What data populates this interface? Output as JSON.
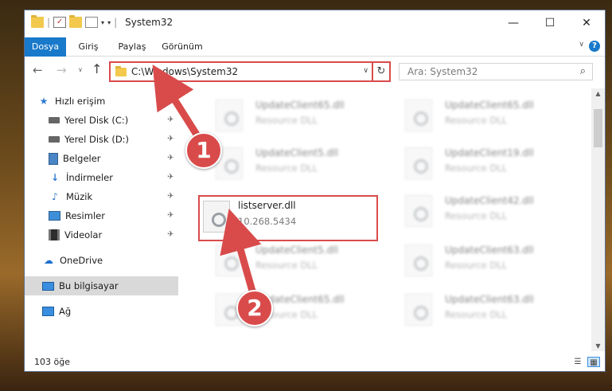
{
  "window": {
    "title": "System32",
    "qat_separator": "|",
    "qat_dropdown": "▾",
    "qat_menu": "▾",
    "controls": {
      "minimize": "—",
      "maximize": "☐",
      "close": "✕"
    }
  },
  "ribbon": {
    "tabs": [
      "Dosya",
      "Giriş",
      "Paylaş",
      "Görünüm"
    ],
    "expand_glyph": "∨",
    "help_glyph": "?"
  },
  "nav": {
    "back_glyph": "←",
    "forward_glyph": "→",
    "history_glyph": "∨",
    "up_glyph": "↑",
    "address": "C:\\Windows\\System32",
    "address_dropdown": "∨",
    "refresh_glyph": "↻",
    "search_placeholder": "Ara: System32",
    "search_glyph": "⌕"
  },
  "sidebar": {
    "pin_glyph": "✈",
    "items": [
      {
        "label": "Hızlı erişim",
        "icon": "star-icon",
        "glyph": "★"
      },
      {
        "label": "Yerel Disk (C:)",
        "icon": "disk-icon"
      },
      {
        "label": "Yerel Disk (D:)",
        "icon": "disk-icon"
      },
      {
        "label": "Belgeler",
        "icon": "document-icon"
      },
      {
        "label": "İndirmeler",
        "icon": "download-icon",
        "glyph": "↓"
      },
      {
        "label": "Müzik",
        "icon": "music-icon",
        "glyph": "♪"
      },
      {
        "label": "Resimler",
        "icon": "pictures-icon"
      },
      {
        "label": "Videolar",
        "icon": "video-icon"
      },
      {
        "label": "OneDrive",
        "icon": "cloud-icon",
        "glyph": "☁"
      },
      {
        "label": "Bu bilgisayar",
        "icon": "computer-icon"
      },
      {
        "label": "Ağ",
        "icon": "network-icon"
      }
    ]
  },
  "files": [
    {
      "name": "UpdateClient65.dll",
      "desc": "Resource DLL"
    },
    {
      "name": "UpdateClient65.dll",
      "desc": "Resource DLL"
    },
    {
      "name": "UpdateClient5.dll",
      "desc": "Resource DLL"
    },
    {
      "name": "UpdateClient19.dll",
      "desc": "Resource DLL"
    },
    {
      "name": "listserver.dll",
      "desc": "10.268.5434"
    },
    {
      "name": "UpdateClient42.dll",
      "desc": "Resource DLL"
    },
    {
      "name": "UpdateClient5.dll",
      "desc": "Resource DLL"
    },
    {
      "name": "UpdateClient63.dll",
      "desc": "Resource DLL"
    },
    {
      "name": "UpdateClient65.dll",
      "desc": "Resource DLL"
    },
    {
      "name": "UpdateClient63.dll",
      "desc": "Resource DLL"
    }
  ],
  "annotations": {
    "step1": "1",
    "step2": "2",
    "accent": "#d94b4b"
  },
  "scrollbar": {
    "up_glyph": "▲",
    "down_glyph": "▼"
  },
  "status": {
    "count": "103 öğe",
    "details_glyph": "☰",
    "tiles_glyph": "▦"
  }
}
